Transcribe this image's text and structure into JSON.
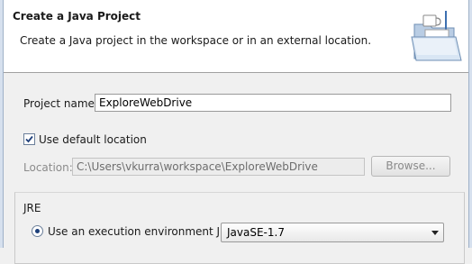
{
  "header": {
    "title": "Create a Java Project",
    "description": "Create a Java project in the workspace or in an external location."
  },
  "project": {
    "name_label": "Project name:",
    "name_value": "ExploreWebDrive"
  },
  "location": {
    "use_default_label": "Use default location",
    "use_default_checked": true,
    "label": "Location:",
    "value": "C:\\Users\\vkurra\\workspace\\ExploreWebDrive",
    "browse_label": "Browse..."
  },
  "jre": {
    "group_label": "JRE",
    "exec_env_label": "Use an execution environment JRE:",
    "exec_env_selected": true,
    "exec_env_value": "JavaSE-1.7"
  },
  "icons": {
    "wizard": "java-project-folder-icon",
    "checkbox": "checkmark-icon",
    "dropdown": "chevron-down-icon"
  }
}
